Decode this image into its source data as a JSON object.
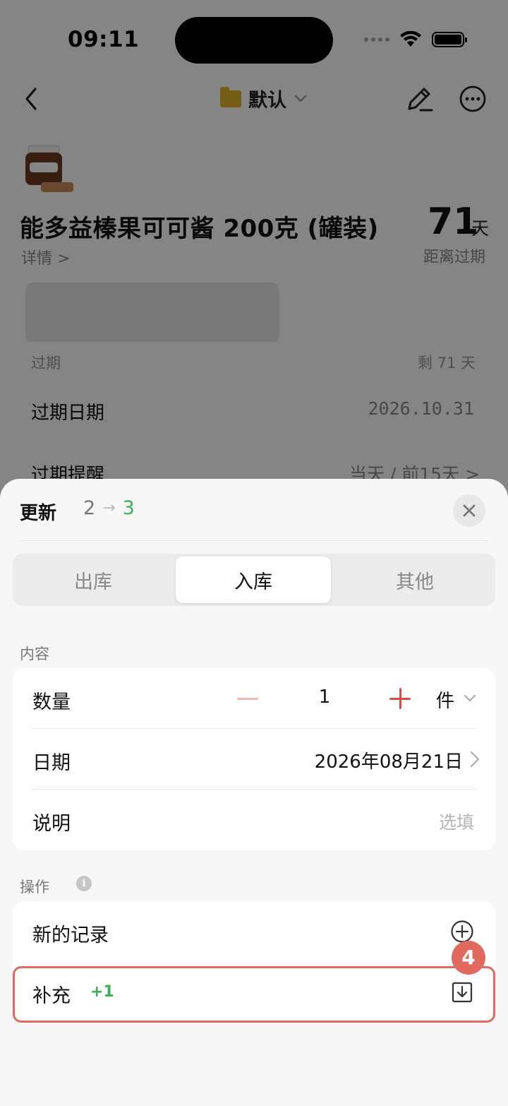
{
  "status_bar": {
    "time": "09:11"
  },
  "nav": {
    "folder_name": "默认"
  },
  "product": {
    "name": "能多益榛果可可酱 200克 (罐装)",
    "detail_link": "详情 >",
    "days_value": "71",
    "days_unit": "天",
    "days_label": "距离过期"
  },
  "expiry_card": {
    "section_label": "过期",
    "remaining": "剩 71 天",
    "expiry_date_label": "过期日期",
    "expiry_date_value": "2026.10.31",
    "reminder_label": "过期提醒",
    "reminder_value": "当天 / 前15天 >"
  },
  "sheet": {
    "title": "更新",
    "version_from": "2",
    "version_arrow": "→",
    "version_to": "3",
    "tabs": [
      {
        "label": "出库",
        "active": false
      },
      {
        "label": "入库",
        "active": true
      },
      {
        "label": "其他",
        "active": false
      }
    ],
    "content_label": "内容",
    "quantity_label": "数量",
    "quantity_value": "1",
    "unit": "件",
    "date_label": "日期",
    "date_value": "2026年08月21日",
    "note_label": "说明",
    "note_placeholder": "选填",
    "actions_label": "操作",
    "info_glyph": "i",
    "new_record_label": "新的记录",
    "replenish_label": "补充",
    "replenish_delta": "+1",
    "step_badge": "4"
  },
  "colors": {
    "accent_green": "#3cb055",
    "accent_red": "#e34b43",
    "highlight": "#e06a5e",
    "folder": "#e0b32d"
  }
}
